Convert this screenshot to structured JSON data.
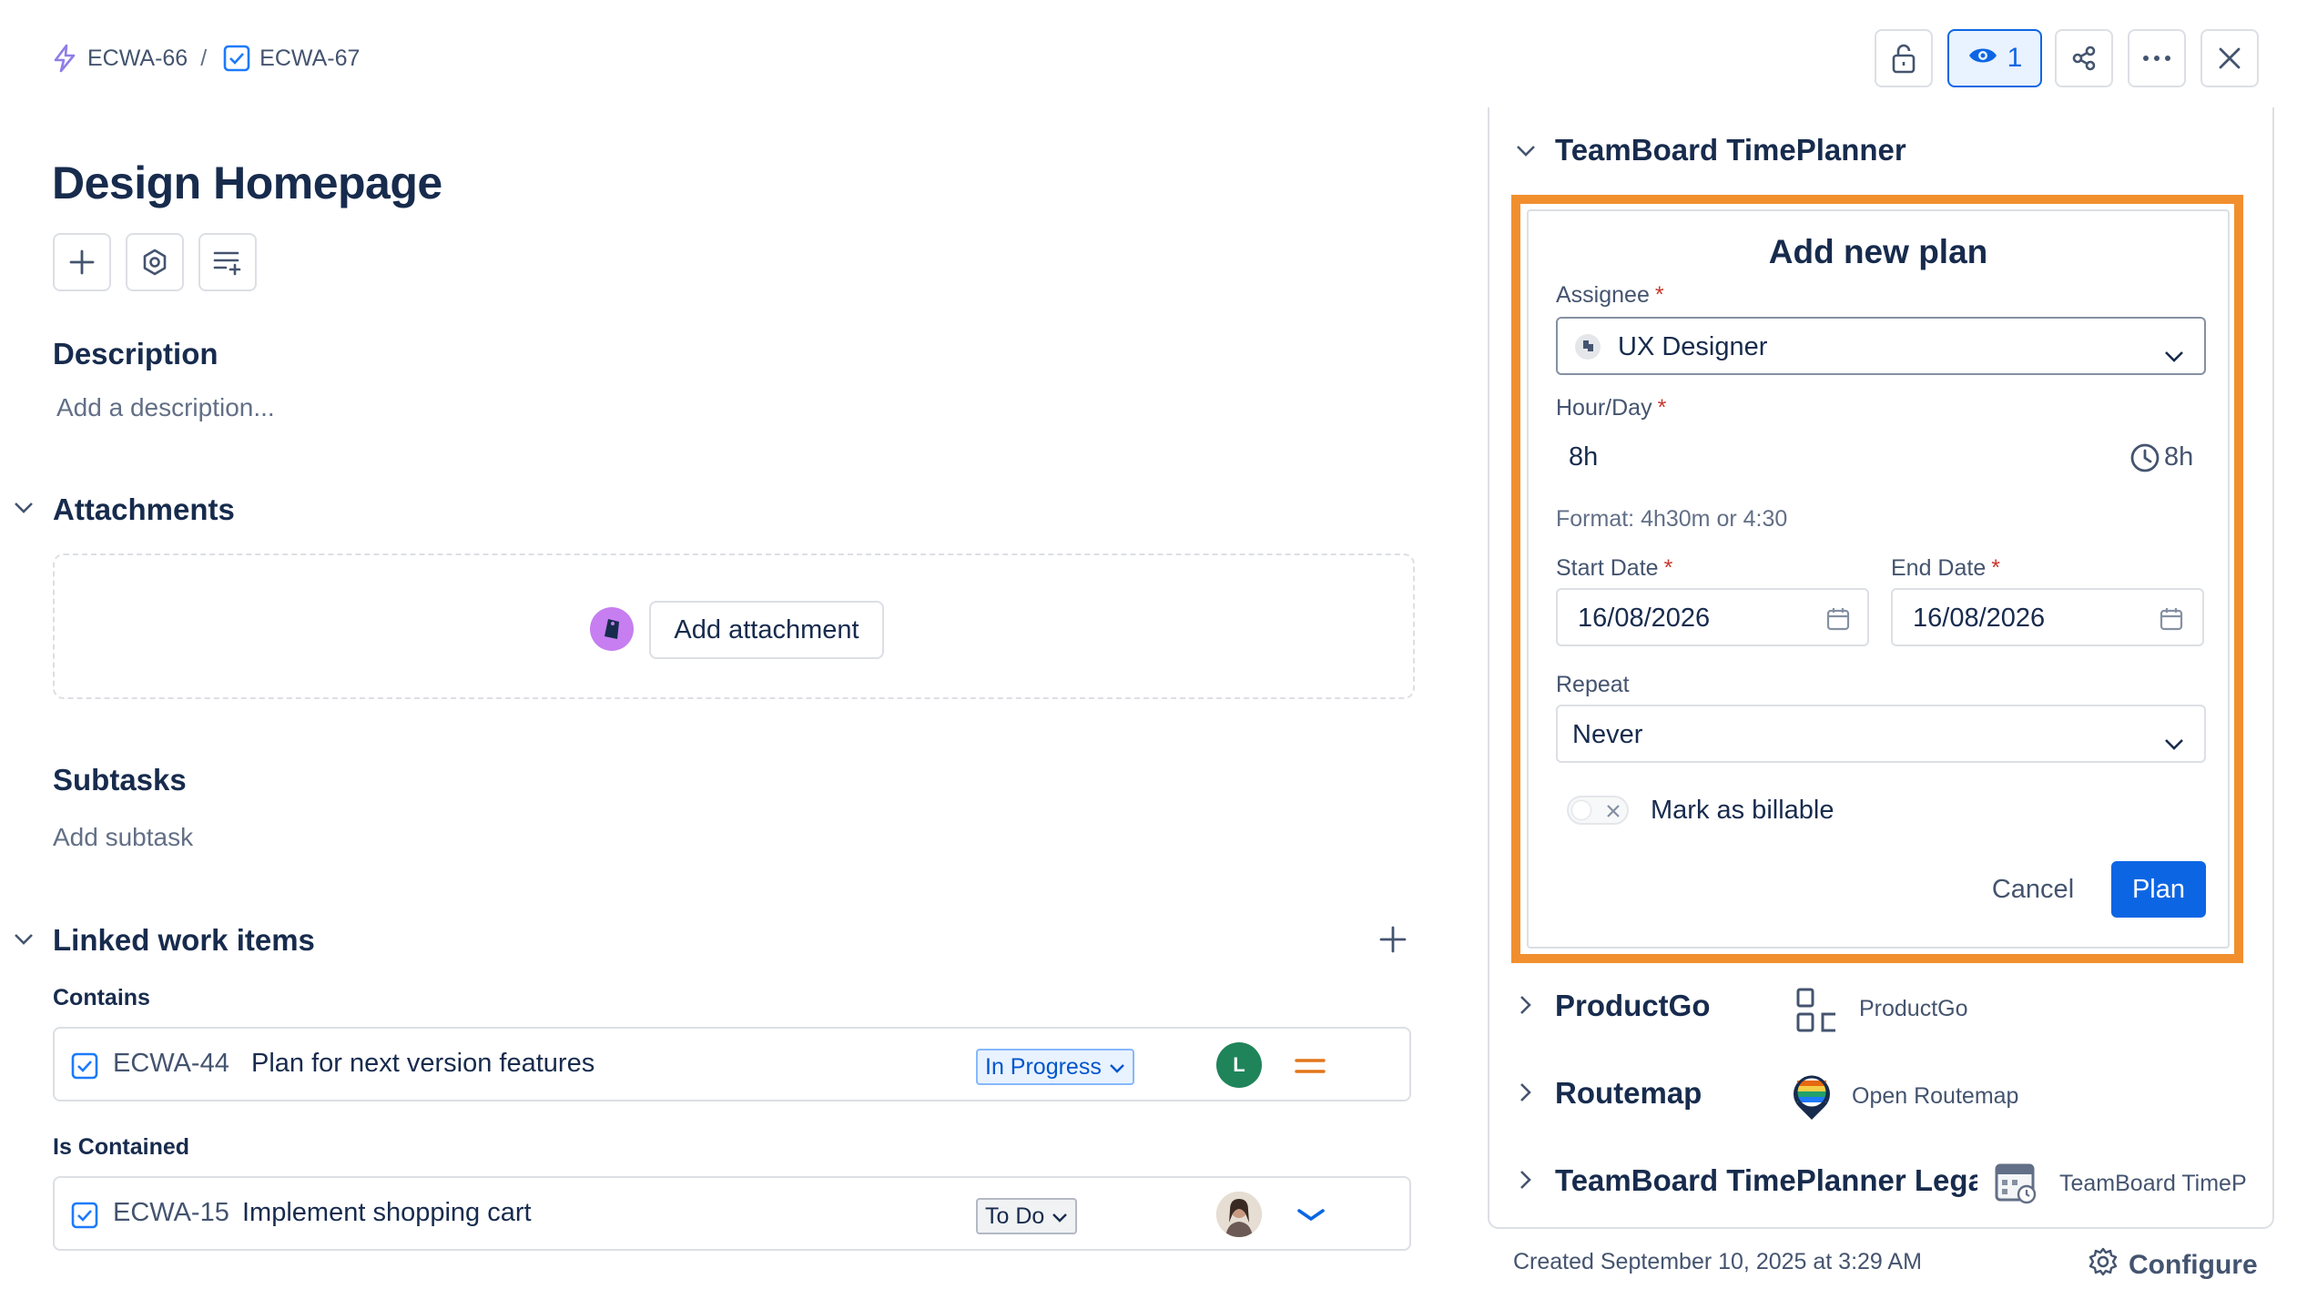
{
  "breadcrumb": {
    "parent": "ECWA-66",
    "separator": "/",
    "current": "ECWA-67"
  },
  "header_actions": {
    "watchers_count": "1"
  },
  "issue": {
    "title": "Design Homepage"
  },
  "description": {
    "heading": "Description",
    "placeholder": "Add a description..."
  },
  "attachments": {
    "heading": "Attachments",
    "button": "Add attachment"
  },
  "subtasks": {
    "heading": "Subtasks",
    "add": "Add subtask"
  },
  "linked": {
    "heading": "Linked work items",
    "groups": [
      {
        "label": "Contains",
        "item": {
          "key": "ECWA-44",
          "summary": "Plan for next version features",
          "status": "In Progress",
          "avatar_initial": "L",
          "priority": "medium"
        }
      },
      {
        "label": "Is Contained",
        "item": {
          "key": "ECWA-15",
          "summary": "Implement shopping cart",
          "status": "To Do",
          "priority": "low"
        }
      }
    ]
  },
  "right_panel": {
    "timeplanner_heading": "TeamBoard TimePlanner",
    "form": {
      "title": "Add new plan",
      "assignee_label": "Assignee",
      "assignee_value": "UX Designer",
      "hours_label": "Hour/Day",
      "hours_value": "8h",
      "hours_total": "8h",
      "format_hint": "Format: 4h30m or 4:30",
      "start_label": "Start Date",
      "start_value": "16/08/2026",
      "end_label": "End Date",
      "end_value": "16/08/2026",
      "repeat_label": "Repeat",
      "repeat_value": "Never",
      "billable_label": "Mark as billable",
      "billable_on": false,
      "required_mark": "*",
      "cancel": "Cancel",
      "submit": "Plan"
    },
    "apps": [
      {
        "title": "ProductGo",
        "subtitle": "ProductGo"
      },
      {
        "title": "Routemap",
        "subtitle": "Open Routemap"
      },
      {
        "title": "TeamBoard TimePlanner Legac",
        "subtitle": "TeamBoard TimeP"
      }
    ]
  },
  "footer": {
    "created": "Created September 10, 2025 at 3:29 AM",
    "configure": "Configure"
  },
  "colors": {
    "accent": "#0c66e4",
    "highlight_border": "#f18f2e",
    "epic_purple": "#8f7ee7"
  }
}
